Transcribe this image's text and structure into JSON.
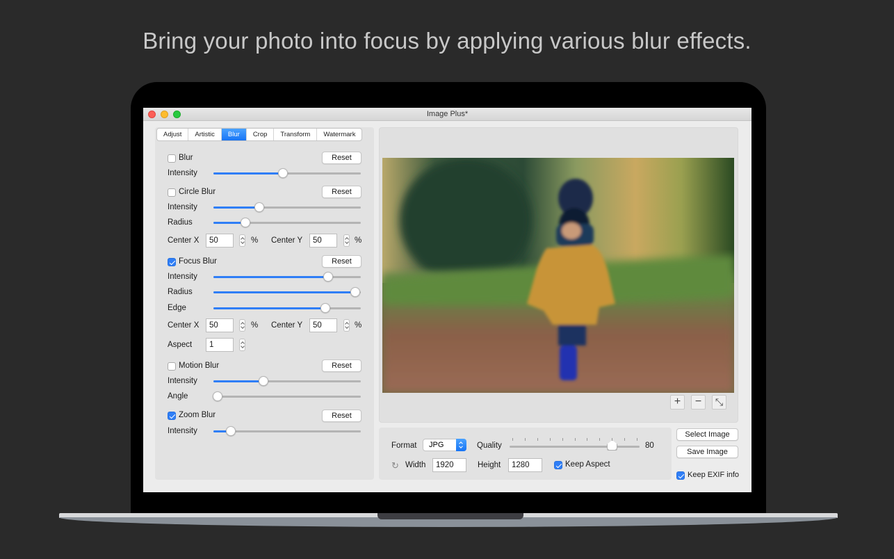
{
  "headline": "Bring your photo into focus by applying various blur effects.",
  "window": {
    "title": "Image Plus*"
  },
  "tabs": [
    {
      "label": "Adjust",
      "active": false
    },
    {
      "label": "Artistic",
      "active": false
    },
    {
      "label": "Blur",
      "active": true
    },
    {
      "label": "Crop",
      "active": false
    },
    {
      "label": "Transform",
      "active": false
    },
    {
      "label": "Watermark",
      "active": false
    }
  ],
  "blur": {
    "label": "Blur",
    "checked": false,
    "reset": "Reset",
    "intensity": {
      "label": "Intensity",
      "value": 0.47
    }
  },
  "circle_blur": {
    "label": "Circle Blur",
    "checked": false,
    "reset": "Reset",
    "intensity": {
      "label": "Intensity",
      "value": 0.31
    },
    "radius": {
      "label": "Radius",
      "value": 0.215
    },
    "center_x": {
      "label": "Center X",
      "value": "50",
      "unit": "%"
    },
    "center_y": {
      "label": "Center Y",
      "value": "50",
      "unit": "%"
    }
  },
  "focus_blur": {
    "label": "Focus Blur",
    "checked": true,
    "reset": "Reset",
    "intensity": {
      "label": "Intensity",
      "value": 0.78
    },
    "radius": {
      "label": "Radius",
      "value": 0.96
    },
    "edge": {
      "label": "Edge",
      "value": 0.76
    },
    "center_x": {
      "label": "Center X",
      "value": "50",
      "unit": "%"
    },
    "center_y": {
      "label": "Center Y",
      "value": "50",
      "unit": "%"
    },
    "aspect": {
      "label": "Aspect",
      "value": "1"
    }
  },
  "motion_blur": {
    "label": "Motion Blur",
    "checked": false,
    "reset": "Reset",
    "intensity": {
      "label": "Intensity",
      "value": 0.34
    },
    "angle": {
      "label": "Angle",
      "value": 0.03
    }
  },
  "zoom_blur": {
    "label": "Zoom Blur",
    "checked": true,
    "reset": "Reset",
    "intensity": {
      "label": "Intensity",
      "value": 0.12
    }
  },
  "preview": {
    "zoom_in": "+",
    "zoom_out": "−",
    "fit": "⤡"
  },
  "export": {
    "format_label": "Format",
    "format_value": "JPG",
    "quality_label": "Quality",
    "quality_value": "80",
    "quality_max": 100,
    "quality_ticks": 11,
    "width_label": "Width",
    "width_value": "1920",
    "height_label": "Height",
    "height_value": "1280",
    "keep_aspect_label": "Keep Aspect",
    "keep_aspect": true,
    "select_image": "Select Image",
    "save_image": "Save Image",
    "keep_exif_label": "Keep EXIF info",
    "keep_exif": true
  },
  "colors": {
    "accent": "#2f7ef6",
    "background": "#2a2a2a"
  }
}
